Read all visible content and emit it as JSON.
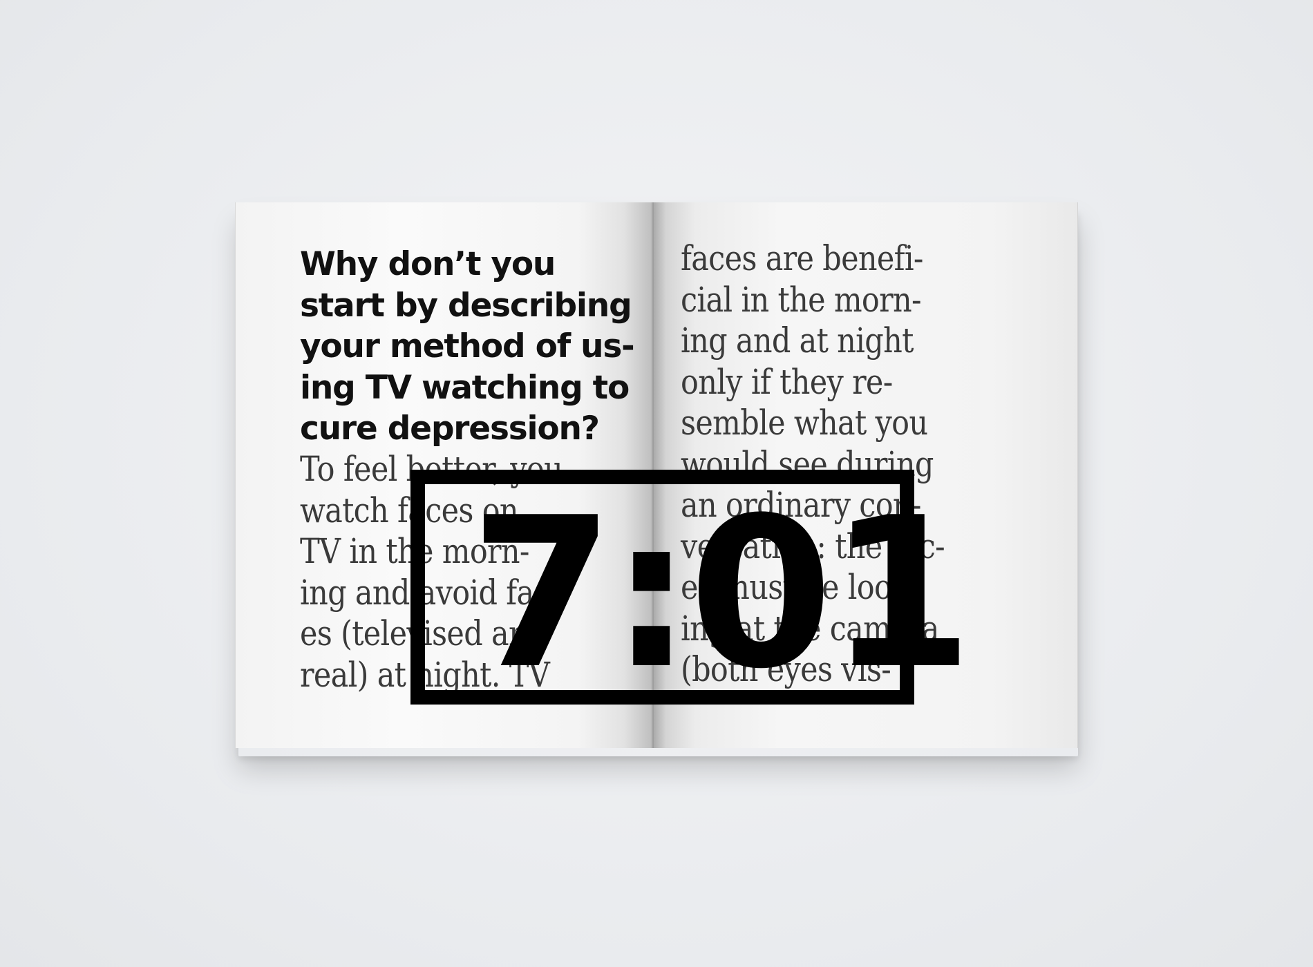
{
  "magazine": {
    "left_page": {
      "question": "Why don’t you start by describing your method of us-ing TV watching to cure depression?",
      "question_lines": [
        "Why don’t you",
        "start by describing",
        "your method of us-",
        "ing TV watching to",
        "cure depression?"
      ],
      "body_lines": [
        "To feel better, you",
        "watch faces on",
        "TV in the morn-",
        "ing and avoid fac-",
        "es (televised and",
        "real) at night. TV"
      ]
    },
    "right_page": {
      "body_lines": [
        "faces are benefi-",
        "cial in the morn-",
        "ing and at night",
        "only if they re-",
        "semble what you",
        "would see during",
        "an ordinary con-",
        "versation: the fac-",
        "es must be look-",
        "ing at the camera",
        "(both eyes vis-"
      ]
    },
    "timer": {
      "display": "7:01"
    }
  }
}
